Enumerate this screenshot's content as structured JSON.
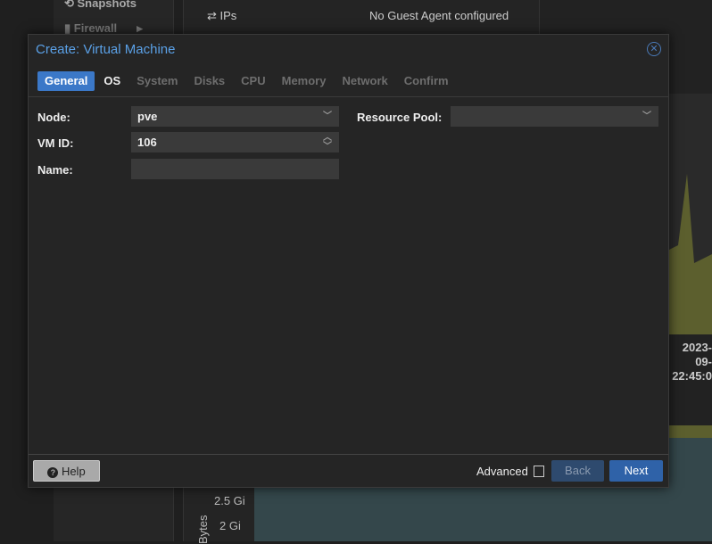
{
  "background": {
    "sidebar_items": [
      {
        "label": "Snapshots",
        "icon": "history-icon"
      },
      {
        "label": "Firewall",
        "icon": "shield-icon"
      }
    ],
    "summary_row": {
      "label": "IPs",
      "icon": "exchange-icon",
      "value": "No Guest Agent configured"
    },
    "chart_time": [
      "2023-09-",
      "22:45:0"
    ],
    "memory_chart": {
      "ylabel": "Bytes",
      "ticks": [
        "2.5 Gi",
        "2 Gi"
      ]
    }
  },
  "dialog": {
    "title": "Create: Virtual Machine",
    "tabs": [
      {
        "label": "General",
        "state": "active"
      },
      {
        "label": "OS",
        "state": "enabled"
      },
      {
        "label": "System",
        "state": "disabled"
      },
      {
        "label": "Disks",
        "state": "disabled"
      },
      {
        "label": "CPU",
        "state": "disabled"
      },
      {
        "label": "Memory",
        "state": "disabled"
      },
      {
        "label": "Network",
        "state": "disabled"
      },
      {
        "label": "Confirm",
        "state": "disabled"
      }
    ],
    "fields": {
      "node": {
        "label": "Node:",
        "value": "pve"
      },
      "vmid": {
        "label": "VM ID:",
        "value": "106"
      },
      "name": {
        "label": "Name:",
        "value": ""
      },
      "pool": {
        "label": "Resource Pool:",
        "value": ""
      }
    },
    "footer": {
      "help": "Help",
      "advanced": "Advanced",
      "advanced_checked": false,
      "back": "Back",
      "next": "Next"
    }
  },
  "colors": {
    "accent": "#3b78c8",
    "title": "#5aa0e6",
    "next": "#2f62a8"
  }
}
